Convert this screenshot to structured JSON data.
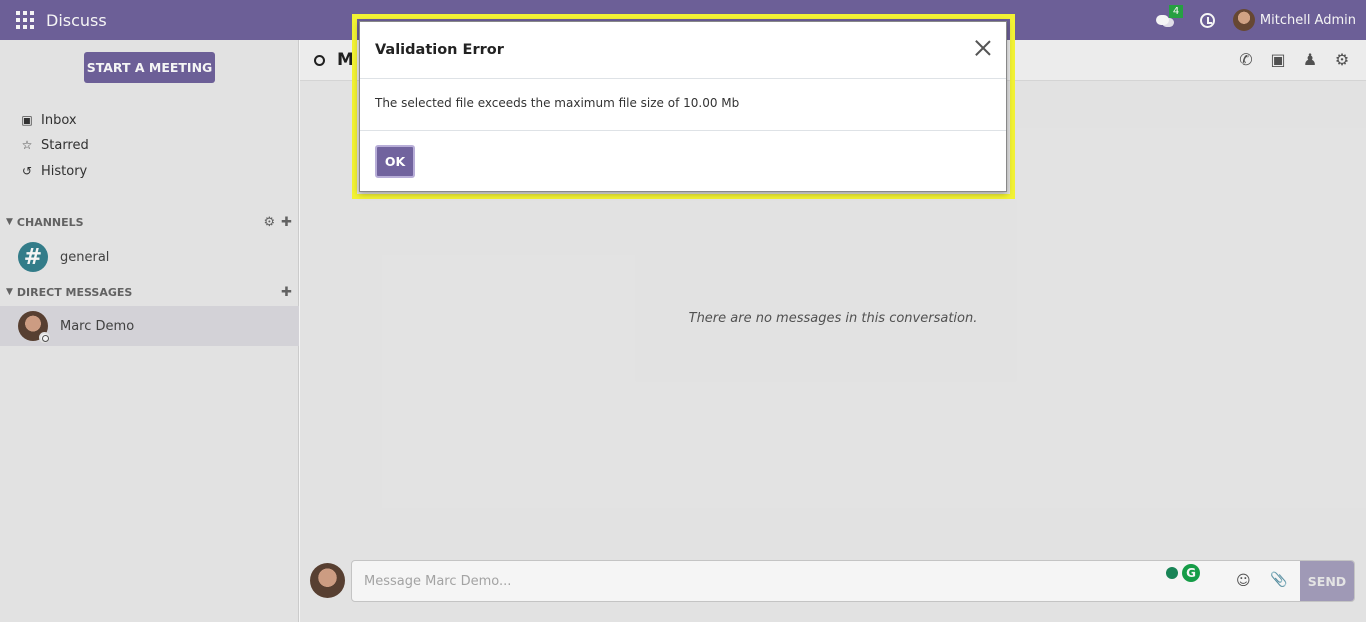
{
  "topbar": {
    "app_name": "Discuss",
    "chat_badge": "4",
    "user_name": "Mitchell Admin"
  },
  "sidebar": {
    "meeting_button": "START A MEETING",
    "nav": [
      {
        "label": "Inbox",
        "icon": "inbox-icon"
      },
      {
        "label": "Starred",
        "icon": "star-icon"
      },
      {
        "label": "History",
        "icon": "history-icon"
      }
    ],
    "channels_header": "CHANNELS",
    "channels": [
      {
        "name": "general"
      }
    ],
    "dm_header": "DIRECT MESSAGES",
    "direct_messages": [
      {
        "name": "Marc Demo"
      }
    ]
  },
  "thread": {
    "title_partial": "M",
    "empty_text": "There are no messages in this conversation.",
    "composer_placeholder": "Message Marc Demo...",
    "send_label": "SEND"
  },
  "dialog": {
    "title": "Validation Error",
    "body": "The selected file exceeds the maximum file size of 10.00 Mb",
    "ok_label": "OK"
  },
  "colors": {
    "brand": "#71639e",
    "highlight": "#f2f234",
    "channel": "#36828f"
  }
}
